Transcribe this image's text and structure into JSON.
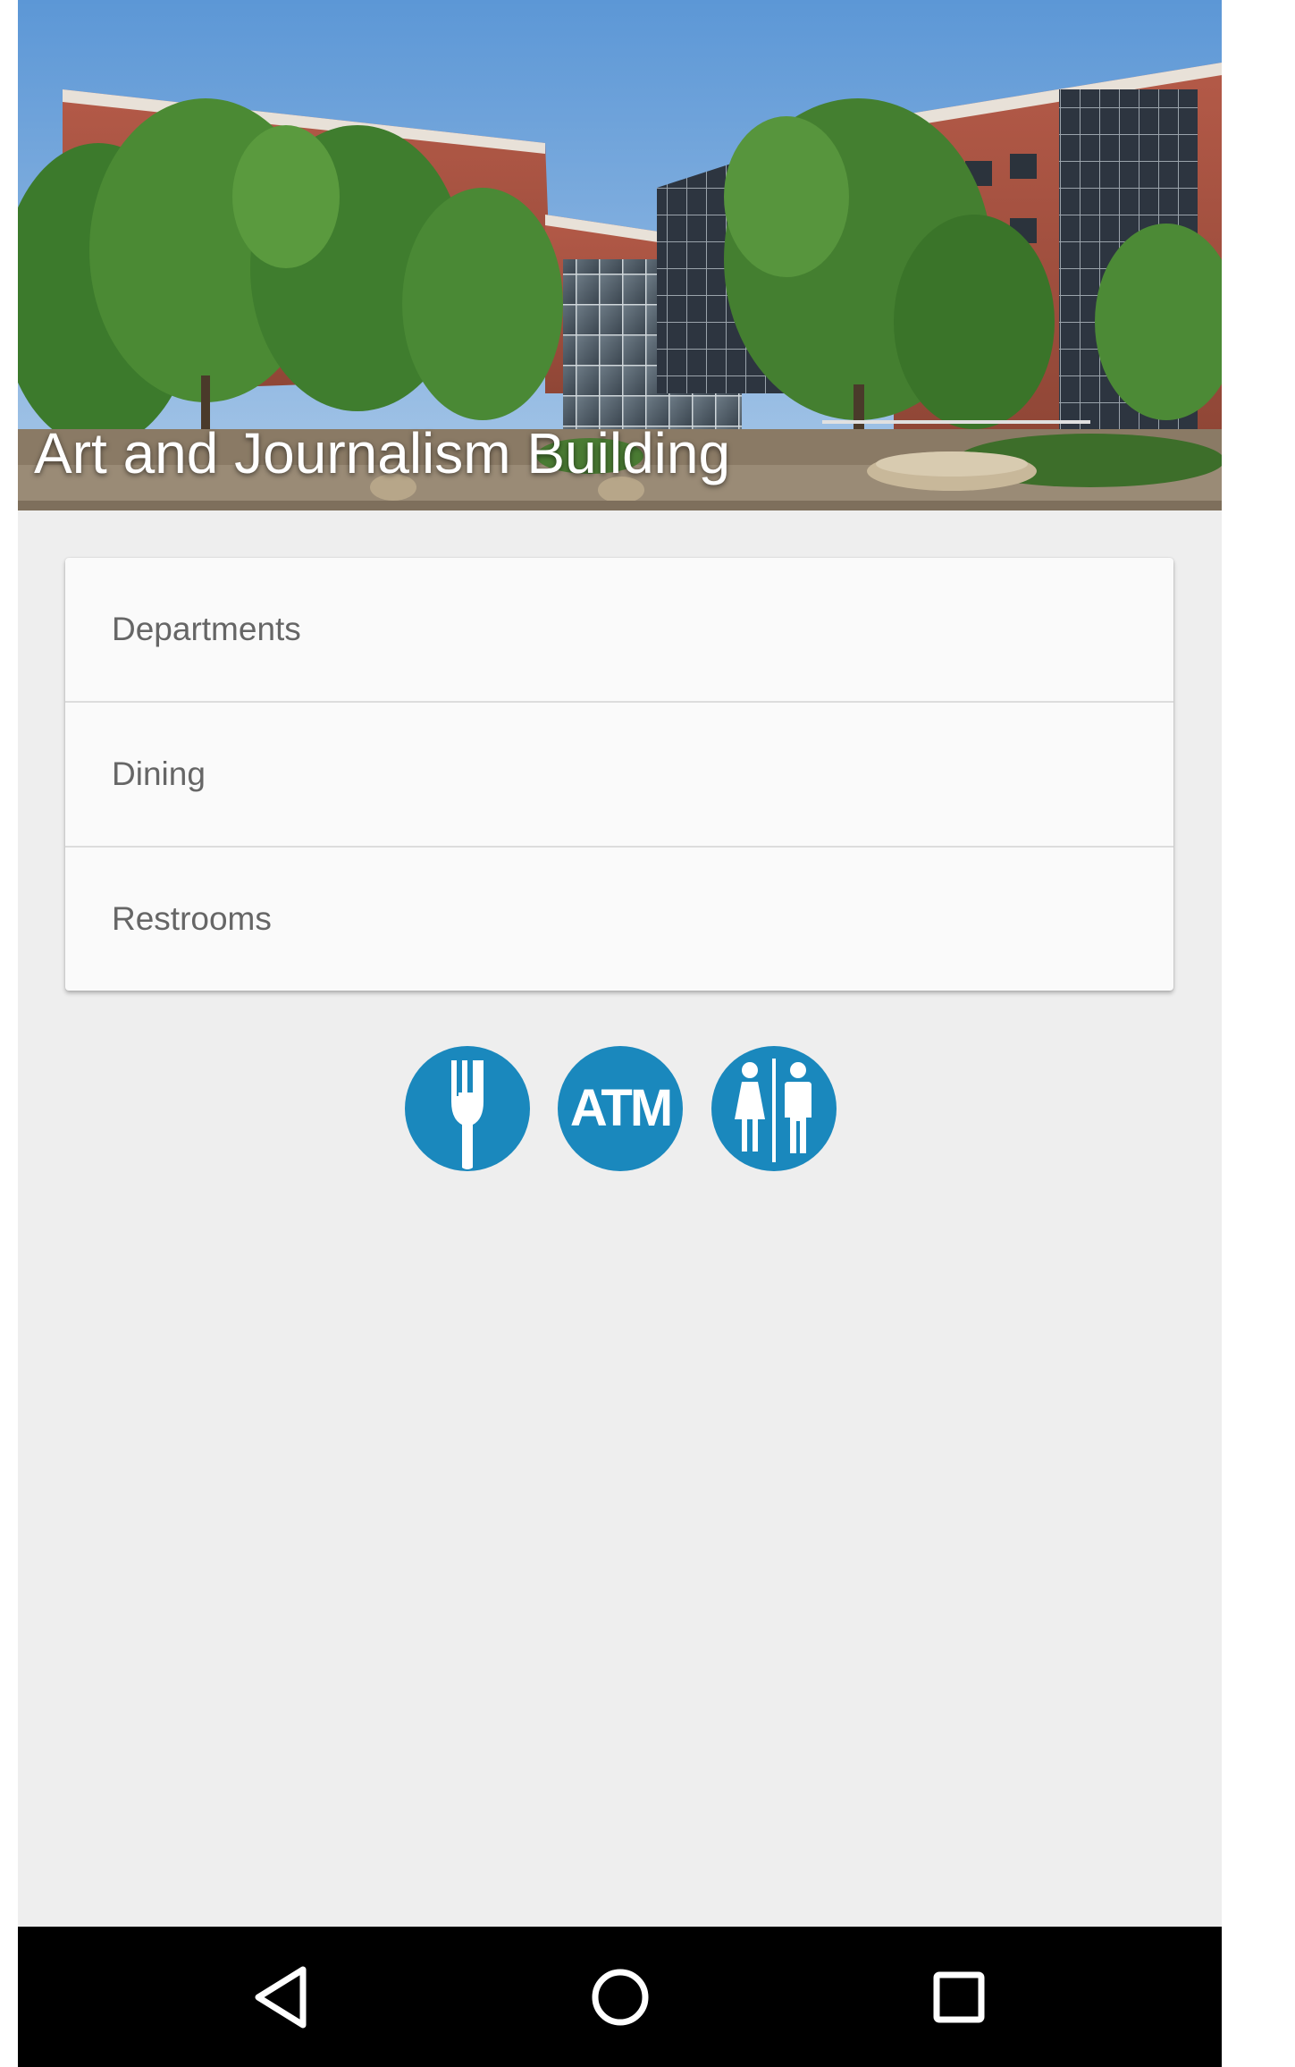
{
  "building": {
    "title": "Art and Journalism Building",
    "image_icon": "building-photo"
  },
  "menu": {
    "items": [
      {
        "label": "Departments"
      },
      {
        "label": "Dining"
      },
      {
        "label": "Restrooms"
      }
    ]
  },
  "amenities": {
    "dining_icon": "fork-icon",
    "atm_label": "ATM",
    "restroom_icon": "restroom-icon",
    "accent_color": "#1a88bd"
  },
  "navbar": {
    "back_icon": "back-triangle-icon",
    "home_icon": "home-circle-icon",
    "recents_icon": "recents-square-icon"
  },
  "colors": {
    "background": "#eeeeee",
    "card": "#fafafa",
    "text": "#666666",
    "navbar": "#000000"
  }
}
